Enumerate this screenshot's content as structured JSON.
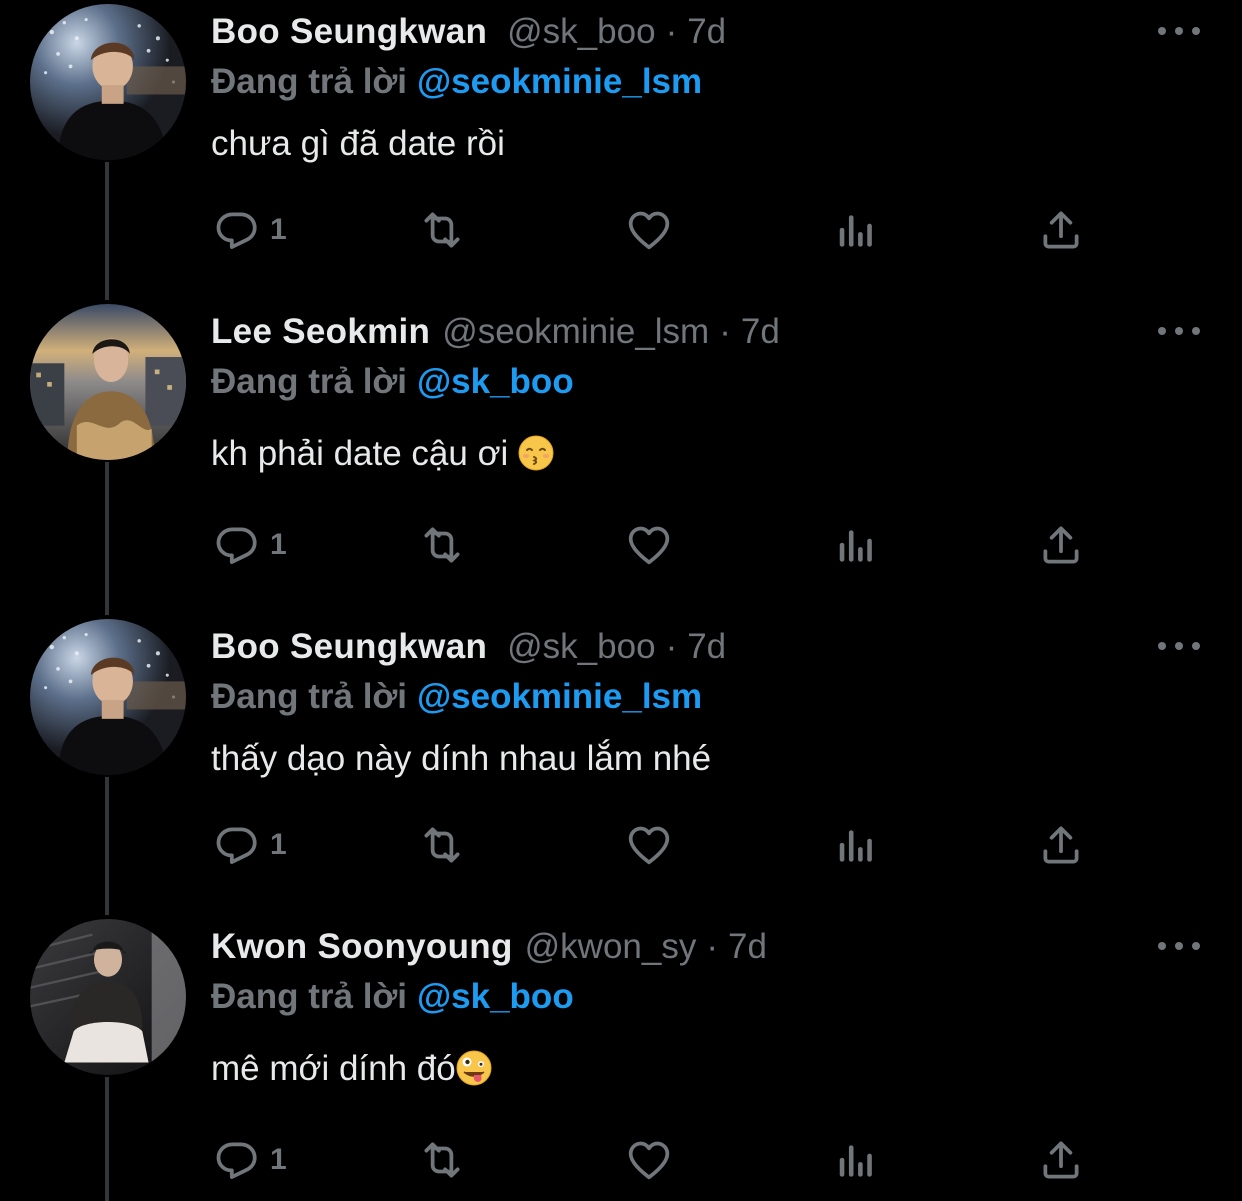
{
  "colors": {
    "background": "#000000",
    "text_primary": "#e7e9ea",
    "text_secondary": "#71767b",
    "mention": "#1d9bf0",
    "thread_line": "#333639"
  },
  "tweets": [
    {
      "name": "Boo Seungkwan",
      "handle": "@sk_boo",
      "separator": "·",
      "time": "7d",
      "replying_label": "Đang trả lời",
      "replying_to": "@seokminie_lsm",
      "text": "chưa gì đã date rồi",
      "emoji": "",
      "reply_count": "1",
      "avatar": "avatar-boo-seungkwan"
    },
    {
      "name": "Lee Seokmin",
      "handle": "@seokminie_lsm",
      "separator": "·",
      "time": "7d",
      "replying_label": "Đang trả lời",
      "replying_to": "@sk_boo",
      "text": "kh phải date cậu ơi",
      "emoji": "kissing-face-emoji",
      "reply_count": "1",
      "avatar": "avatar-lee-seokmin"
    },
    {
      "name": "Boo Seungkwan",
      "handle": "@sk_boo",
      "separator": "·",
      "time": "7d",
      "replying_label": "Đang trả lời",
      "replying_to": "@seokminie_lsm",
      "text": "thấy dạo này dính nhau lắm nhé",
      "emoji": "",
      "reply_count": "1",
      "avatar": "avatar-boo-seungkwan"
    },
    {
      "name": "Kwon Soonyoung",
      "handle": "@kwon_sy",
      "separator": "·",
      "time": "7d",
      "replying_label": "Đang trả lời",
      "replying_to": "@sk_boo",
      "text": "mê mới dính đó",
      "emoji": "zany-face-emoji",
      "reply_count": "1",
      "avatar": "avatar-kwon-soonyoung"
    }
  ],
  "icons": {
    "reply": "reply-icon",
    "retweet": "retweet-icon",
    "like": "heart-icon",
    "stats": "stats-icon",
    "share": "share-icon",
    "more": "more-icon"
  }
}
